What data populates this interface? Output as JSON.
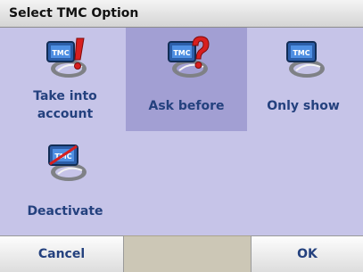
{
  "window": {
    "title": "Select TMC Option"
  },
  "options": [
    {
      "label_line1": "Take into",
      "label_line2": "account",
      "icon": "tmc-alert-icon"
    },
    {
      "label": "Ask before",
      "icon": "tmc-question-icon"
    },
    {
      "label": "Only show",
      "icon": "tmc-icon"
    },
    {
      "label": "Deactivate",
      "icon": "tmc-deactivated-icon"
    }
  ],
  "icon_text": "TMC",
  "selected_option": "Ask before",
  "buttons": {
    "cancel": "Cancel",
    "ok": "OK"
  },
  "colors": {
    "background": "#c6c4e8",
    "selected": "#a29fd3",
    "label": "#24417e",
    "alert_red": "#d81f1f"
  }
}
